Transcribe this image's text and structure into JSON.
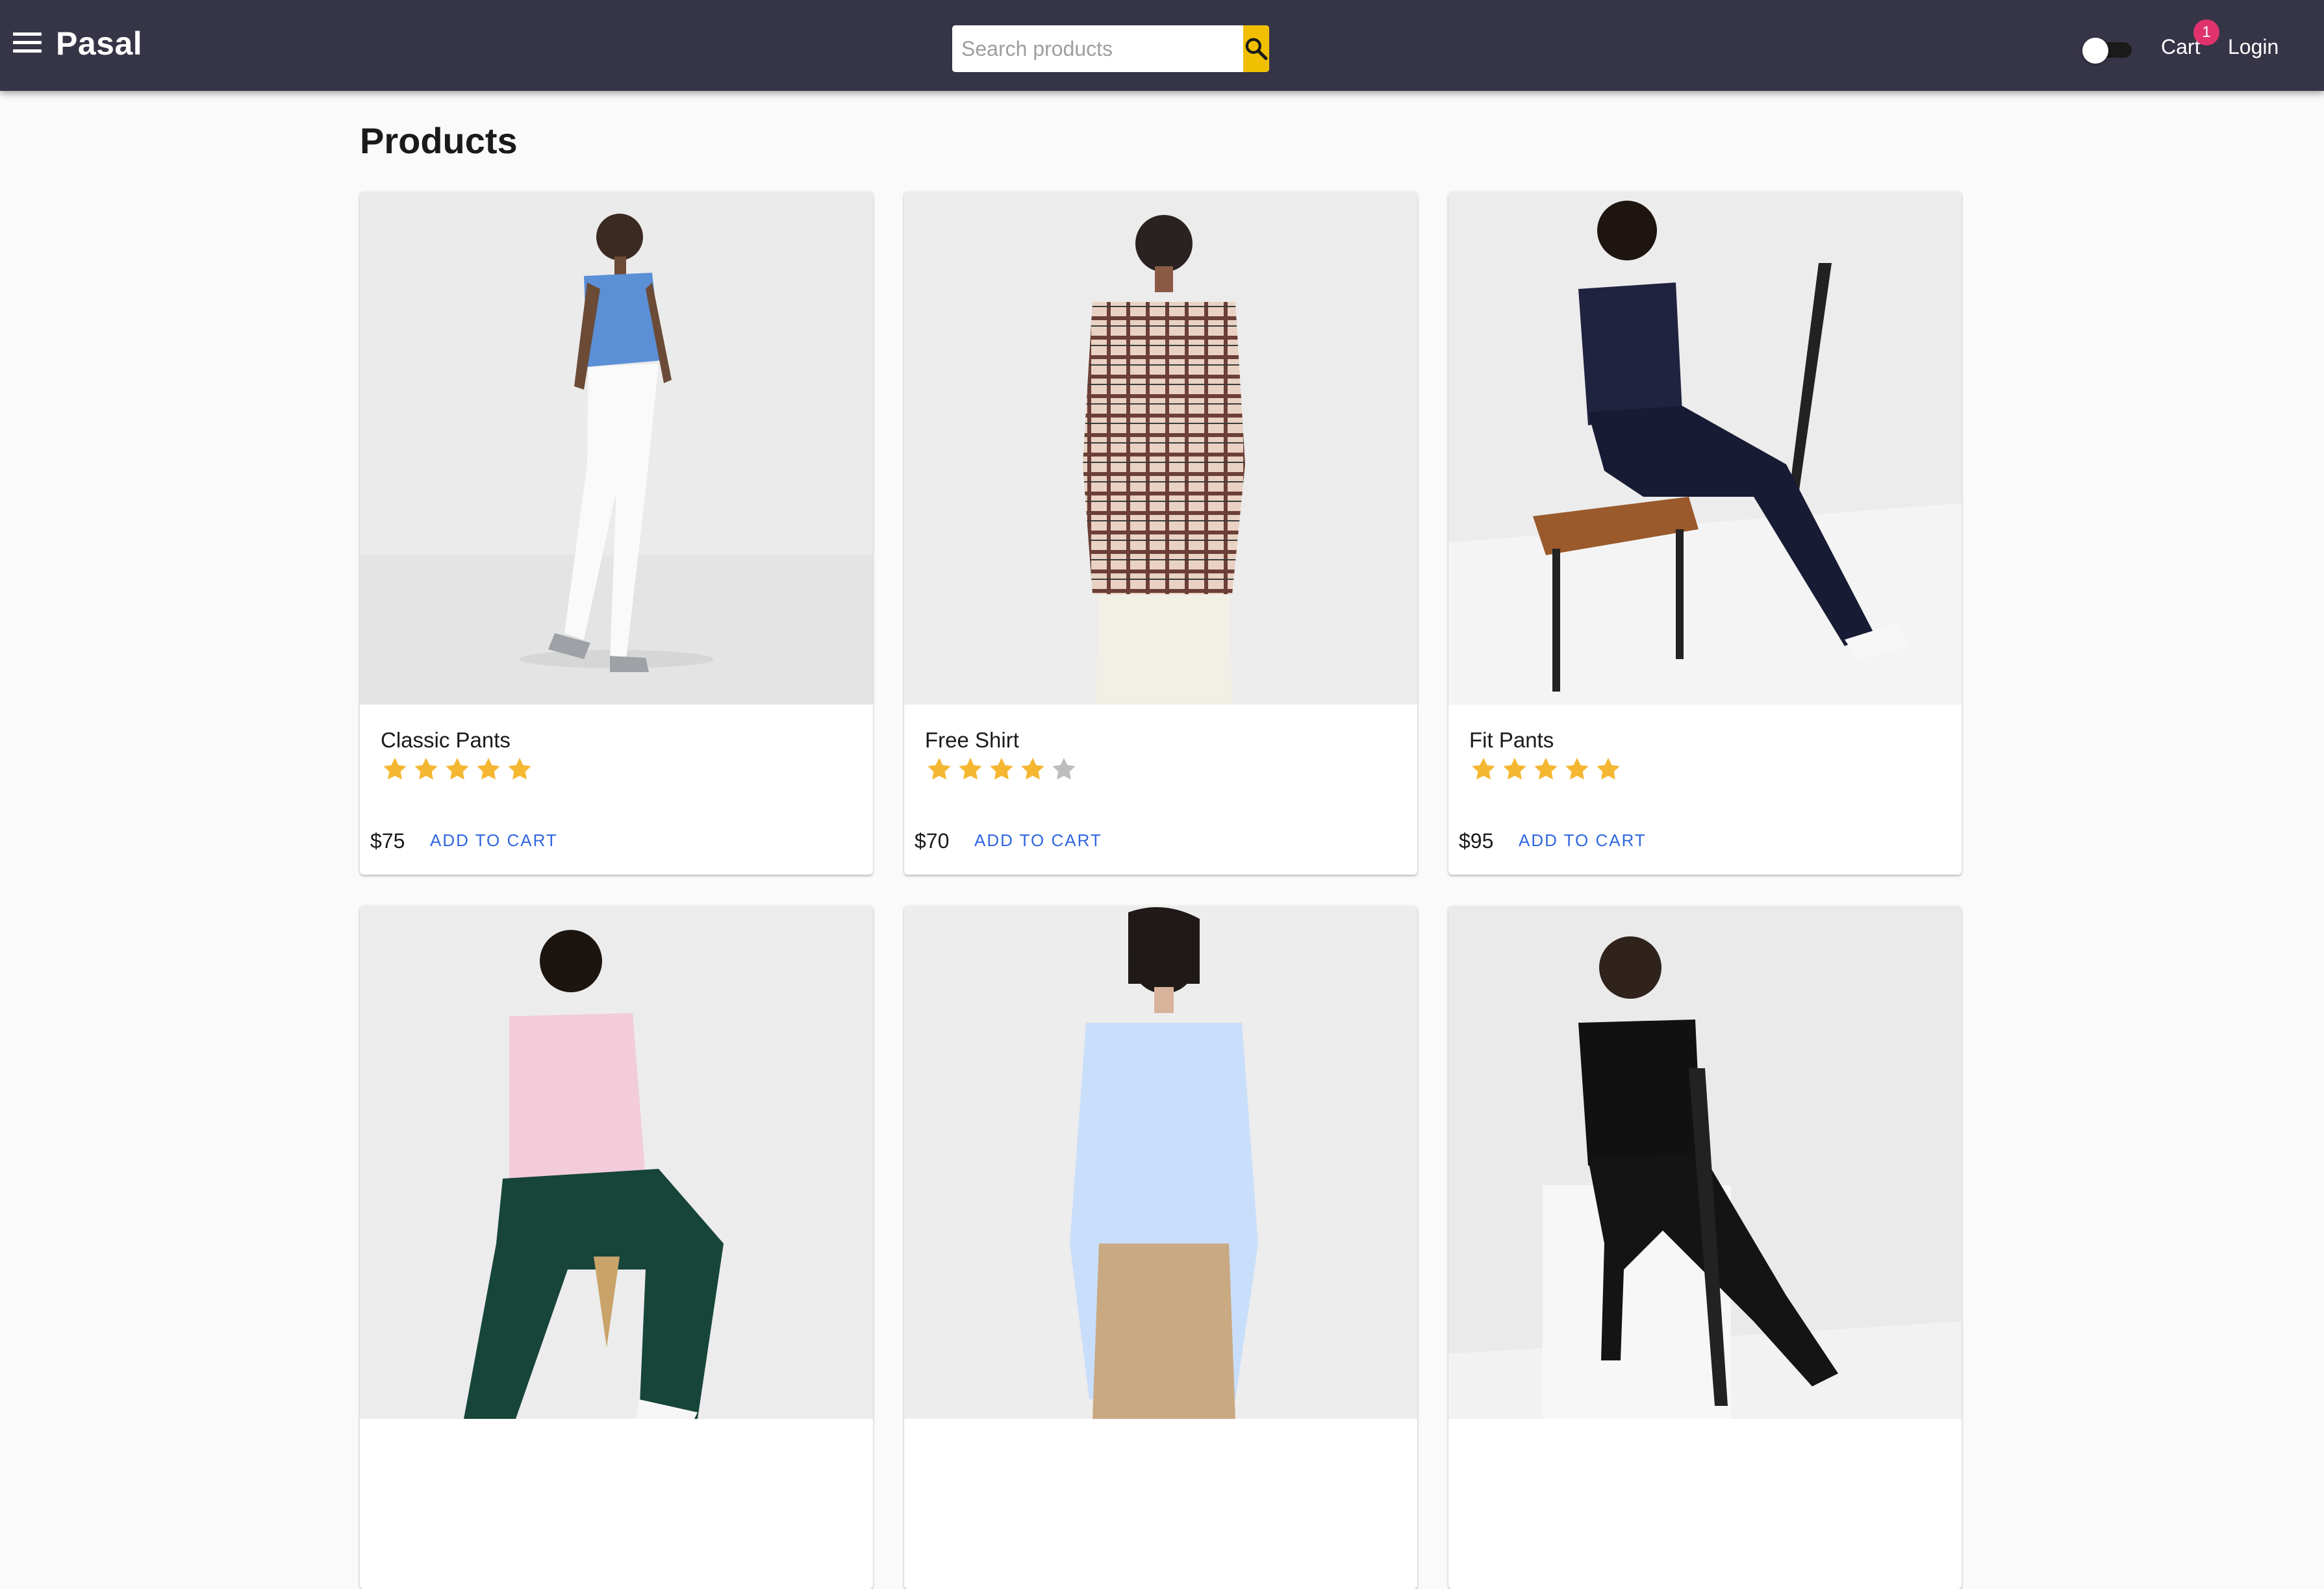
{
  "app": {
    "brand": "Pasal",
    "search_placeholder": "Search products",
    "cart_label": "Cart",
    "cart_count": "1",
    "login_label": "Login",
    "theme_toggle_on": false
  },
  "page": {
    "title": "Products"
  },
  "products": [
    {
      "name": "Classic Pants",
      "rating": 5,
      "price": "$75",
      "action": "ADD TO CART"
    },
    {
      "name": "Free Shirt",
      "rating": 4,
      "price": "$70",
      "action": "ADD TO CART"
    },
    {
      "name": "Fit Pants",
      "rating": 5,
      "price": "$95",
      "action": "ADD TO CART"
    },
    {
      "name": "",
      "rating": null,
      "price": "",
      "action": ""
    },
    {
      "name": "",
      "rating": null,
      "price": "",
      "action": ""
    },
    {
      "name": "",
      "rating": null,
      "price": "",
      "action": ""
    }
  ],
  "colors": {
    "appbar": "#363547",
    "search_button": "#f0c000",
    "badge": "#e0336e",
    "star_filled": "#f5b731",
    "star_empty": "#bdbdbd",
    "action": "#2f66e0"
  }
}
